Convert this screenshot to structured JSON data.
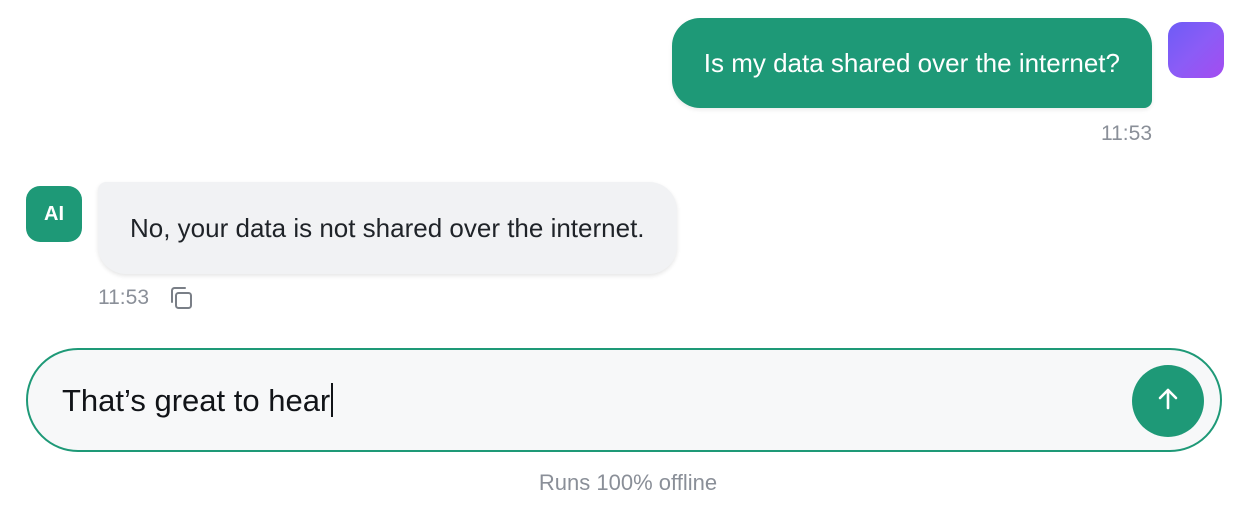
{
  "messages": {
    "user": {
      "text": "Is my data shared over the internet?",
      "time": "11:53"
    },
    "assistant": {
      "avatar_label": "AI",
      "text": "No, your data is not shared over the internet.",
      "time": "11:53",
      "copy_icon": "copy-icon"
    }
  },
  "composer": {
    "value": "That’s great to hear",
    "send_icon": "arrow-up-icon"
  },
  "footer": {
    "note": "Runs 100% offline"
  },
  "colors": {
    "accent": "#1e9977",
    "user_avatar_gradient": [
      "#6d5cf6",
      "#a44cf0"
    ],
    "assistant_bubble": "#f1f2f4",
    "muted_text": "#8a8f98"
  }
}
